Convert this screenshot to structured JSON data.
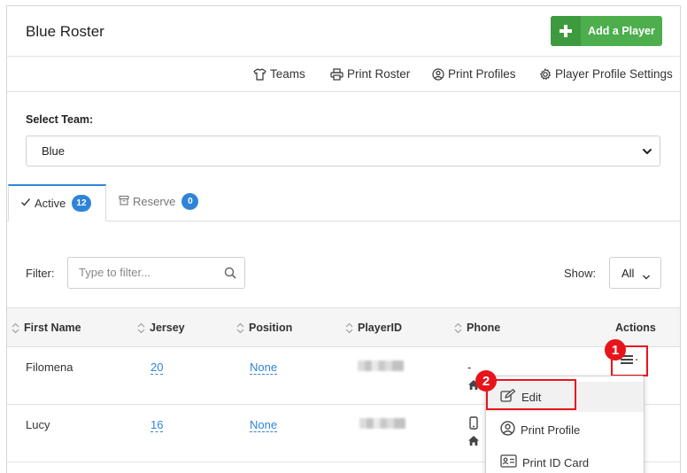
{
  "header": {
    "title": "Blue Roster",
    "add_button_label": "Add a Player"
  },
  "toolbar": {
    "items": [
      {
        "label": "Teams",
        "icon": "tshirt-icon"
      },
      {
        "label": "Print Roster",
        "icon": "printer-icon"
      },
      {
        "label": "Print Profiles",
        "icon": "user-circle-icon"
      },
      {
        "label": "Player Profile Settings",
        "icon": "gear-icon"
      }
    ]
  },
  "team_select": {
    "label": "Select Team:",
    "value": "Blue"
  },
  "tabs": [
    {
      "label": "Active",
      "count": "12",
      "icon": "check-icon"
    },
    {
      "label": "Reserve",
      "count": "0",
      "icon": "archive-icon"
    }
  ],
  "filter": {
    "label": "Filter:",
    "placeholder": "Type to filter...",
    "show_label": "Show:",
    "show_value": "All"
  },
  "table": {
    "columns": [
      "First Name",
      "Jersey",
      "Position",
      "PlayerID",
      "Phone",
      "Actions"
    ],
    "rows": [
      {
        "first_name": "Filomena",
        "jersey": "20",
        "position": "None",
        "phone": "-"
      },
      {
        "first_name": "Lucy",
        "jersey": "16",
        "position": "None",
        "phone": ""
      }
    ]
  },
  "actions_menu": {
    "items": [
      {
        "label": "Edit",
        "icon": "edit-icon"
      },
      {
        "label": "Print Profile",
        "icon": "user-circle-icon"
      },
      {
        "label": "Print ID Card",
        "icon": "id-card-icon"
      }
    ]
  },
  "annotations": {
    "step1": "1",
    "step2": "2"
  },
  "colors": {
    "accent": "#2f84d8",
    "primary_green": "#4cae4c",
    "highlight_red": "#e8141b"
  }
}
